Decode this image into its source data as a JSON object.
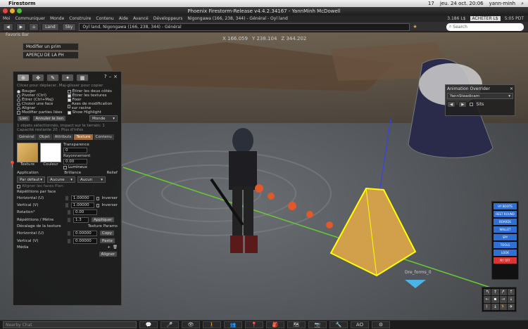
{
  "mac": {
    "app": "Firestorm",
    "time": "jeu. 24 oct.  20:06",
    "user": "yann-minh",
    "battery": "17"
  },
  "window": {
    "title": "Phoenix Firestorm-Release v4.4.2.34167 - YannMinh McDowell"
  },
  "menu": {
    "items": [
      "Moi",
      "Communiquer",
      "Monde",
      "Construire",
      "Contenu",
      "Aide",
      "Avancé",
      "Développeurs",
      "Nigongawa (166, 238, 344) - Général - Oyl land"
    ],
    "balance": "3.186 L$",
    "buy": "ACHETER L$",
    "time": "5:05 PDT"
  },
  "nav": {
    "land": "Land",
    "sky": "Sky",
    "location": "Oyl land, Nigongawa (166, 238, 344) - Général",
    "search_placeholder": "Search"
  },
  "coords": {
    "x": "X 166.059",
    "y": "Y 238.104",
    "z": "Z 344.202"
  },
  "sidebar": {
    "favorites": "Favoris Bar"
  },
  "notifications": [
    {
      "label": "Modifier un prim"
    },
    {
      "label": "APERÇU DE LA PH"
    }
  ],
  "tools": {
    "hint": "Clicez pour déplacer, Maj-glisser pour copier",
    "options_left": [
      {
        "label": "Bouger",
        "on": true
      },
      {
        "label": "Pivoter (Ctrl)",
        "on": false
      },
      {
        "label": "Étirer (Ctrl+Maj)",
        "on": false
      },
      {
        "label": "Choisir une face",
        "on": false
      },
      {
        "label": "Aligner",
        "on": false
      },
      {
        "label": "Modifier parties liées",
        "on": false
      }
    ],
    "options_right": [
      {
        "label": "Étirer les deux côtés",
        "on": false
      },
      {
        "label": "Étirer les textures",
        "on": true
      },
      {
        "label": "Fixer",
        "on": true
      },
      {
        "label": "Axes de modification sur racine",
        "on": false
      },
      {
        "label": "Show Highlight",
        "on": true
      }
    ],
    "link": "Lien",
    "unlink": "Annuler le lien",
    "world": "Monde",
    "selection": "1 objets sélectionnés, impact sur le terrain: 1",
    "capacity": "Capacité restante 20 : Plus d'infos",
    "tabs": [
      "Général",
      "Objet",
      "Attributs",
      "Texture",
      "Contenu"
    ],
    "selected_tab": "Texture",
    "texture_label": "Texture",
    "color_label": "Couleur",
    "transparency": "Transparence",
    "transparency_val": "0",
    "glow": "Rayonnement",
    "glow_val": "0.00",
    "luminous": "Lumineux",
    "application": "Application",
    "application_val": "Par défaut",
    "shininess": "Brillance",
    "shininess_val": "Aucune",
    "bumpiness": "Relief",
    "bumpiness_val": "Aucun",
    "align_planar": "Aligner les faces Plan.",
    "repeats": "Répétitions par face",
    "horizontal_u": "Horizontal (U)",
    "horizontal_u_val": "1.00000",
    "vertical_v": "Vertical (V)",
    "vertical_v_val": "1.00000",
    "flip": "Inverser",
    "rotation": "Rotation°",
    "rotation_val": "0.00",
    "repeats_per_meter": "Répétitions / Mètre",
    "rpm_val": "1.3",
    "apply": "Appliquer",
    "offset": "Décalage de la texture",
    "tex_params": "Texture Params",
    "offset_u": "Horizontal (U)",
    "offset_u_val": "0.00000",
    "offset_v": "Vertical (V)",
    "offset_v_val": "0.00000",
    "copy": "Copy",
    "paste": "Paste",
    "media": "Média",
    "align": "Aligner"
  },
  "ao": {
    "title": "Animation Overrider",
    "value": "YannSteadicam",
    "sits": "Sits"
  },
  "hud": {
    "buttons": [
      "HY BOOTS",
      "REST ROUND",
      "BOARDS",
      "WALLET",
      "SPY",
      "TOOLS",
      "LOOK",
      "NY OFF"
    ]
  },
  "scene": {
    "drefs": "Dre_forms_0"
  },
  "bottom": {
    "chat_placeholder": "Nearby Chat",
    "ao": "AO"
  },
  "colors": {
    "accent": "#a16a3c",
    "hud_blue": "#2f6fd8"
  }
}
